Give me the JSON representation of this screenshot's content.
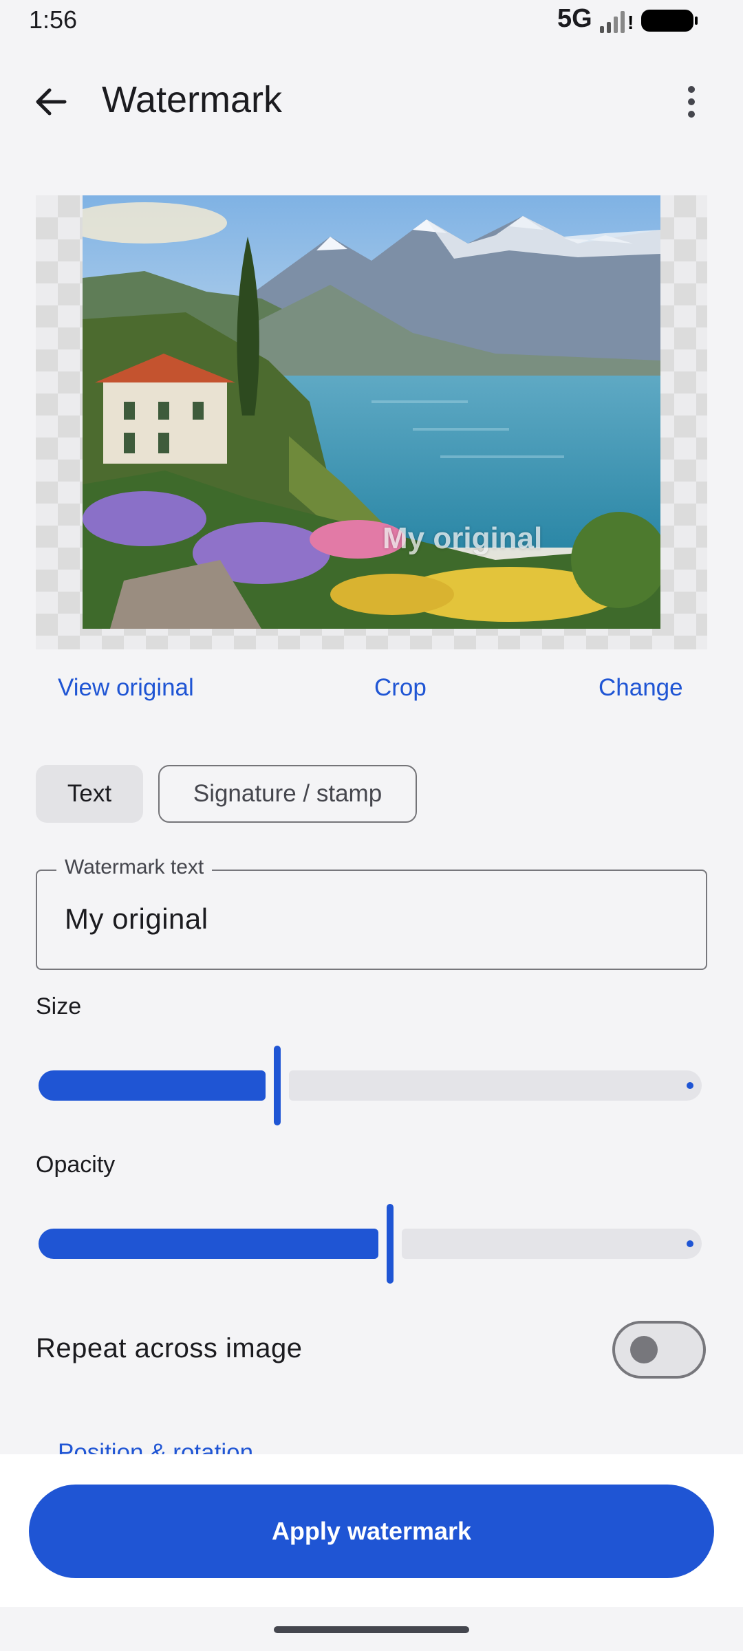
{
  "status_bar": {
    "time": "1:56",
    "network": "5G"
  },
  "app_bar": {
    "title": "Watermark"
  },
  "preview": {
    "watermark_overlay_text": "My original"
  },
  "actions": {
    "view_original": "View original",
    "crop": "Crop",
    "change": "Change"
  },
  "modes": {
    "text": "Text",
    "signature": "Signature / stamp",
    "selected": "Text"
  },
  "watermark_field": {
    "label": "Watermark text",
    "value": "My original"
  },
  "size": {
    "label": "Size",
    "value_fraction": 0.36
  },
  "opacity": {
    "label": "Opacity",
    "value_fraction": 0.53
  },
  "repeat": {
    "label": "Repeat across image",
    "enabled": false
  },
  "position_link": "Position & rotation",
  "apply_button": "Apply watermark",
  "colors": {
    "accent": "#1f55d4",
    "background": "#f4f4f6"
  }
}
